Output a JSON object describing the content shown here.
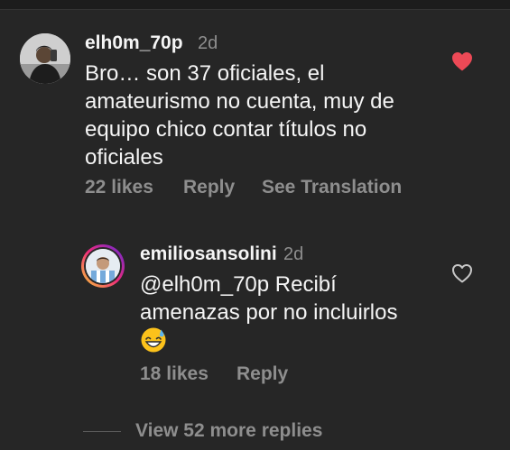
{
  "comment": {
    "username": "elh0m_70p",
    "time": "2d",
    "lines": [
      "Bro… son 37 oficiales, el",
      "amateurismo no cuenta, muy de",
      "equipo chico contar títulos no",
      "oficiales"
    ],
    "likes": "22 likes",
    "reply_label": "Reply",
    "translate_label": "See Translation",
    "liked": true
  },
  "reply": {
    "username": "emiliosansolini",
    "time": "2d",
    "mention": "@elh0m_70p",
    "line1_rest": " Recibí",
    "line2": "amenazas por no incluirlos",
    "emoji": "😅",
    "likes": "18 likes",
    "reply_label": "Reply",
    "liked": false
  },
  "view_more": "View 52 more replies",
  "colors": {
    "background": "#262626",
    "text": "#f5f5f5",
    "secondary": "#8e8e8e",
    "heart_liked": "#ed4956"
  },
  "icons": {
    "liked": "heart-filled-icon",
    "unliked": "heart-outline-icon"
  }
}
